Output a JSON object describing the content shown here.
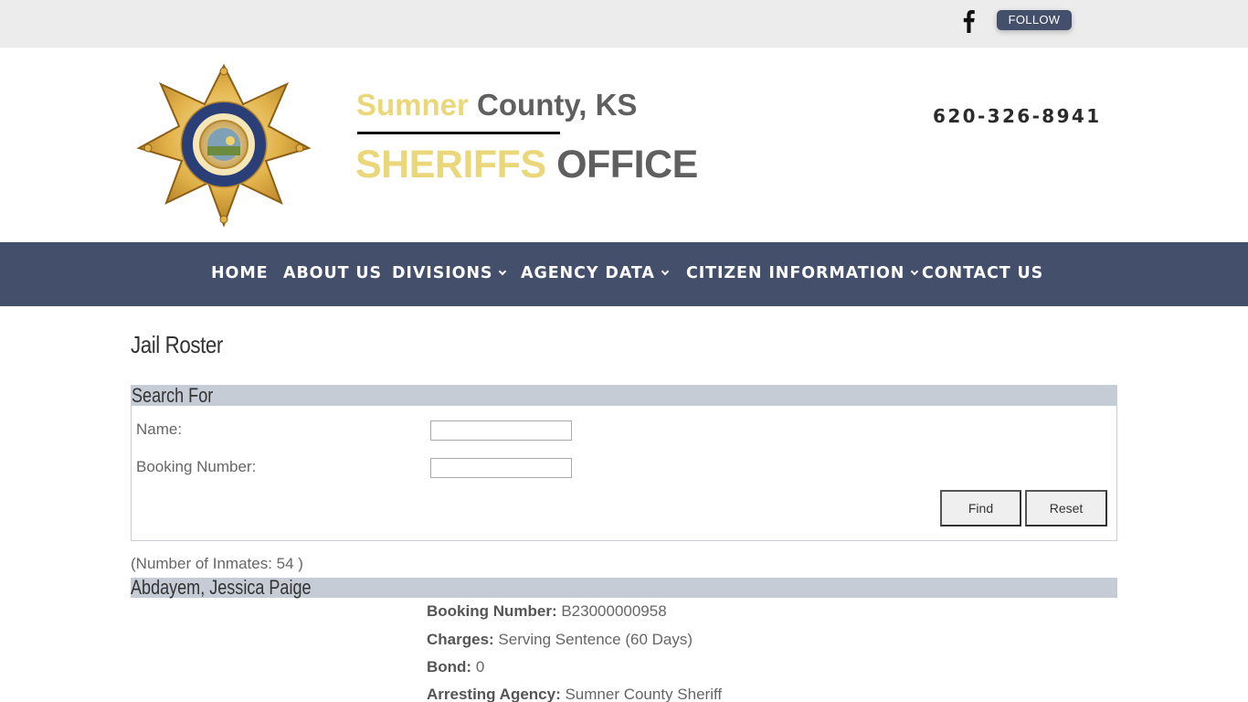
{
  "topbar": {
    "social_icon": "facebook-icon",
    "follow_label": "FOLLOW"
  },
  "header": {
    "logo": "sheriff-star-badge",
    "title_highlight": "Sumner",
    "title_rest": " County, KS",
    "subtitle_highlight": "SHERIFFS",
    "subtitle_rest": " OFFICE",
    "phone": "620-326-8941"
  },
  "nav": {
    "items": [
      {
        "label": "HOME"
      },
      {
        "label": "ABOUT US"
      },
      {
        "label": "DIVISIONS"
      },
      {
        "label": "AGENCY DATA"
      },
      {
        "label": "CITIZEN INFORMATION"
      },
      {
        "label": "CONTACT US"
      }
    ]
  },
  "page": {
    "title": "Jail Roster"
  },
  "search": {
    "heading": "Search For",
    "name_label": "Name:",
    "name_value": "",
    "booking_label": "Booking Number:",
    "booking_value": "",
    "find_label": "Find",
    "reset_label": "Reset"
  },
  "roster": {
    "count_text": "(Number of Inmates: 54 )",
    "inmates": [
      {
        "name": "Abdayem, Jessica Paige",
        "booking_label": "Booking Number:",
        "booking_value": " B23000000958",
        "charges_label": "Charges:",
        "charges_value": " Serving Sentence (60 Days)",
        "bond_label": "Bond:",
        "bond_value": " 0",
        "agency_label": "Arresting Agency:",
        "agency_value": " Sumner County Sheriff"
      }
    ]
  },
  "colors": {
    "nav_bg": "#444f6c",
    "accent_gold": "#ead77a",
    "header_gray": "#5f5f5f",
    "section_bar": "#c6ccd6"
  }
}
